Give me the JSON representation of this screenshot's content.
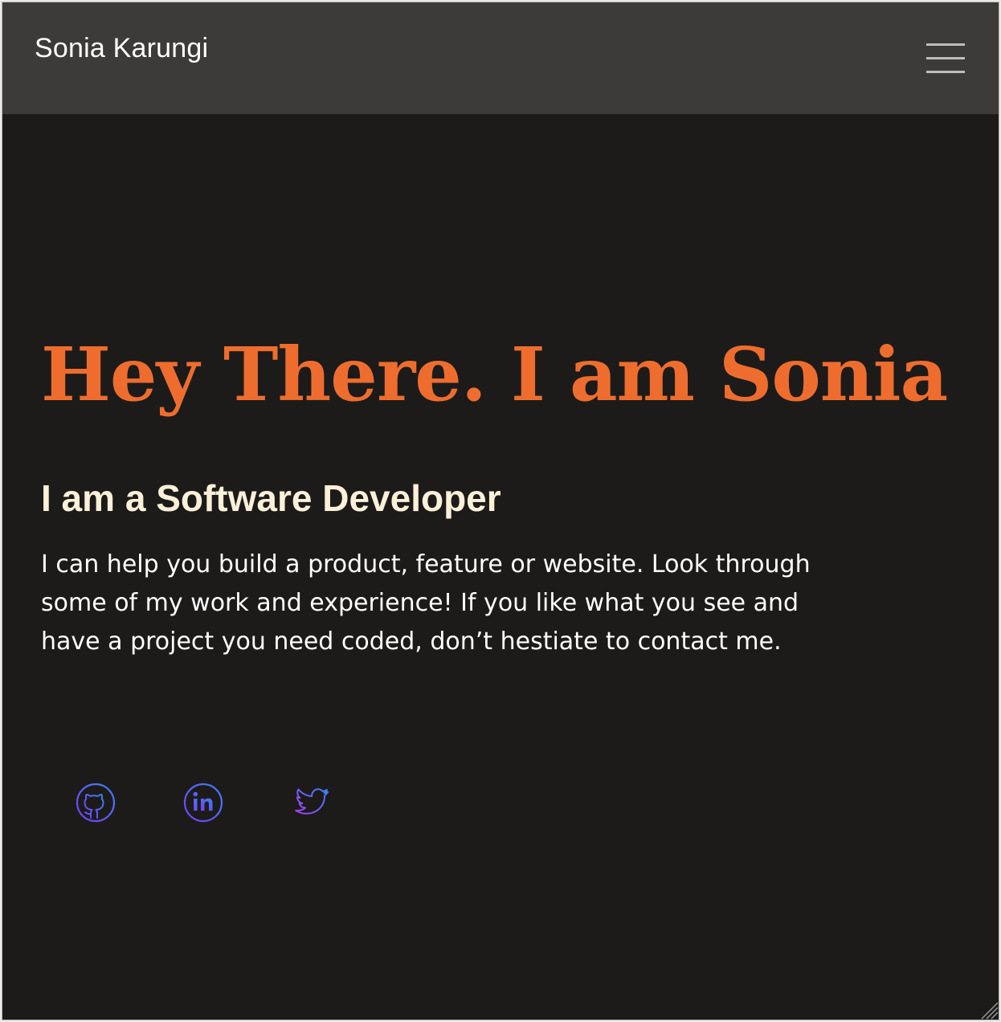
{
  "navbar": {
    "brand": "Sonia Karungi",
    "menu_icon": "hamburger-menu-icon"
  },
  "hero": {
    "title": "Hey There. I am Sonia",
    "subtitle": "I am a Software Developer",
    "intro": "I can help you build a product, feature or website. Look through some of my work and experience! If you like what you see and have a project you need coded, don’t hestiate to contact me."
  },
  "socials": [
    {
      "icon": "github-icon"
    },
    {
      "icon": "linkedin-icon"
    },
    {
      "icon": "twitter-icon"
    }
  ],
  "colors": {
    "page_bg": "#1c1b1a",
    "navbar_bg": "#3c3b3a",
    "accent": "#ee6d2e",
    "subtitle": "#fbf0d8",
    "text": "#ffffff",
    "icon_gradient_start": "#7a3cf5",
    "icon_gradient_end": "#3b82f6"
  }
}
